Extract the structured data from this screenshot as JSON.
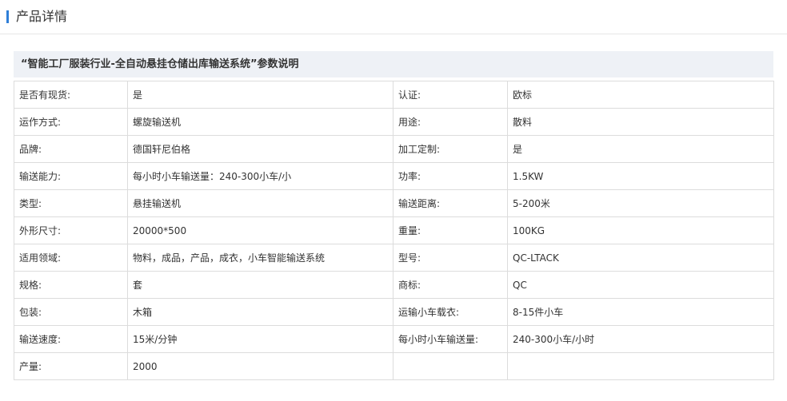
{
  "section": {
    "title": "产品详情"
  },
  "params": {
    "title": "“智能工厂服装行业-全自动悬挂仓储出库输送系统”参数说明",
    "rows": [
      {
        "l1": "是否有现货:",
        "v1": "是",
        "l2": "认证:",
        "v2": "欧标"
      },
      {
        "l1": "运作方式:",
        "v1": "螺旋输送机",
        "l2": "用途:",
        "v2": "散料"
      },
      {
        "l1": "品牌:",
        "v1": "德国轩尼伯格",
        "l2": "加工定制:",
        "v2": "是"
      },
      {
        "l1": "输送能力:",
        "v1": "每小时小车输送量：240-300小车/小",
        "l2": "功率:",
        "v2": "1.5KW"
      },
      {
        "l1": "类型:",
        "v1": "悬挂输送机",
        "l2": "输送距离:",
        "v2": "5-200米"
      },
      {
        "l1": "外形尺寸:",
        "v1": "20000*500",
        "l2": "重量:",
        "v2": "100KG"
      },
      {
        "l1": "适用领域:",
        "v1": "物料，成品，产品，成衣，小车智能输送系统",
        "l2": "型号:",
        "v2": "QC-LTACK"
      },
      {
        "l1": "规格:",
        "v1": "套",
        "l2": "商标:",
        "v2": "QC"
      },
      {
        "l1": "包装:",
        "v1": "木箱",
        "l2": "运输小车载衣:",
        "v2": "8-15件小车"
      },
      {
        "l1": "输送速度:",
        "v1": "15米/分钟",
        "l2": "每小时小车输送量:",
        "v2": "240-300小车/小时"
      },
      {
        "l1": "产量:",
        "v1": "2000",
        "l2": "",
        "v2": ""
      }
    ]
  }
}
